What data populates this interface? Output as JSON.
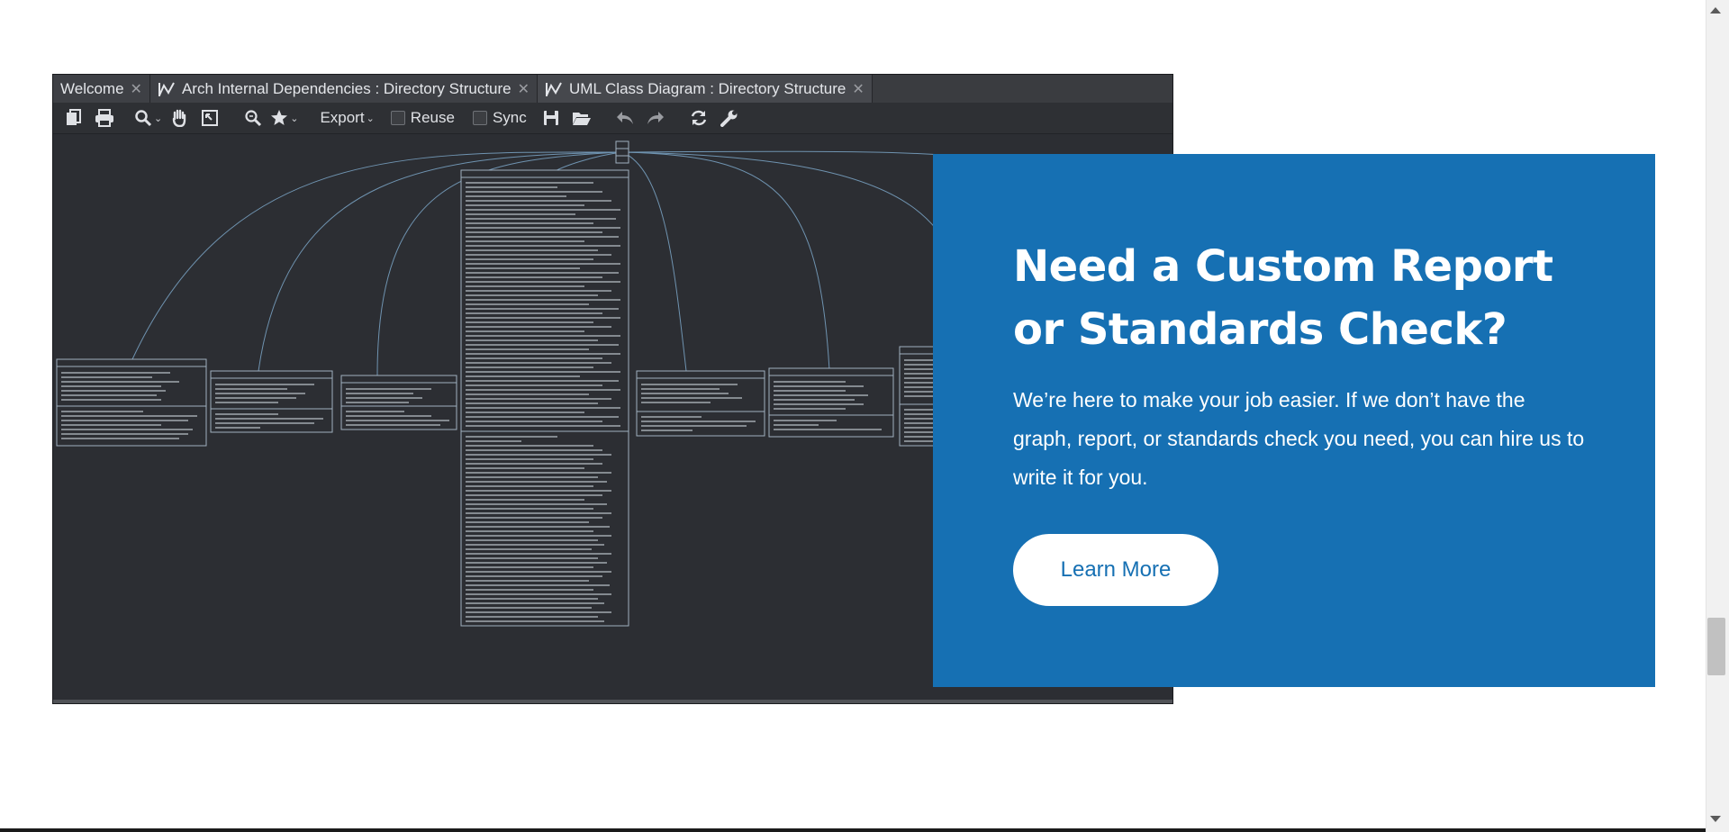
{
  "tool_screenshot": {
    "tabs": [
      {
        "label": "Welcome",
        "close": "✕"
      },
      {
        "label": "Arch Internal Dependencies : Directory Structure",
        "close": "✕"
      },
      {
        "label": "UML Class Diagram : Directory Structure",
        "close": "✕"
      }
    ],
    "toolbar": {
      "export_label": "Export",
      "reuse_label": "Reuse",
      "sync_label": "Sync",
      "icons": [
        "copy-icon",
        "print-icon",
        "zoom-icon",
        "hand-icon",
        "fit-icon",
        "zoom-fit-icon",
        "star-icon",
        "save-icon",
        "open-folder-icon",
        "undo-icon",
        "redo-icon",
        "refresh-icon",
        "wrench-icon"
      ]
    }
  },
  "cta": {
    "title": "Need a Custom Report or Standards Check?",
    "body": "We’re here to make your job easier. If we don’t have the graph, report, or standards check you need, you can hire us to write it for you.",
    "button_label": "Learn More",
    "background_color": "#1670b3",
    "button_text_color": "#1670b3"
  }
}
